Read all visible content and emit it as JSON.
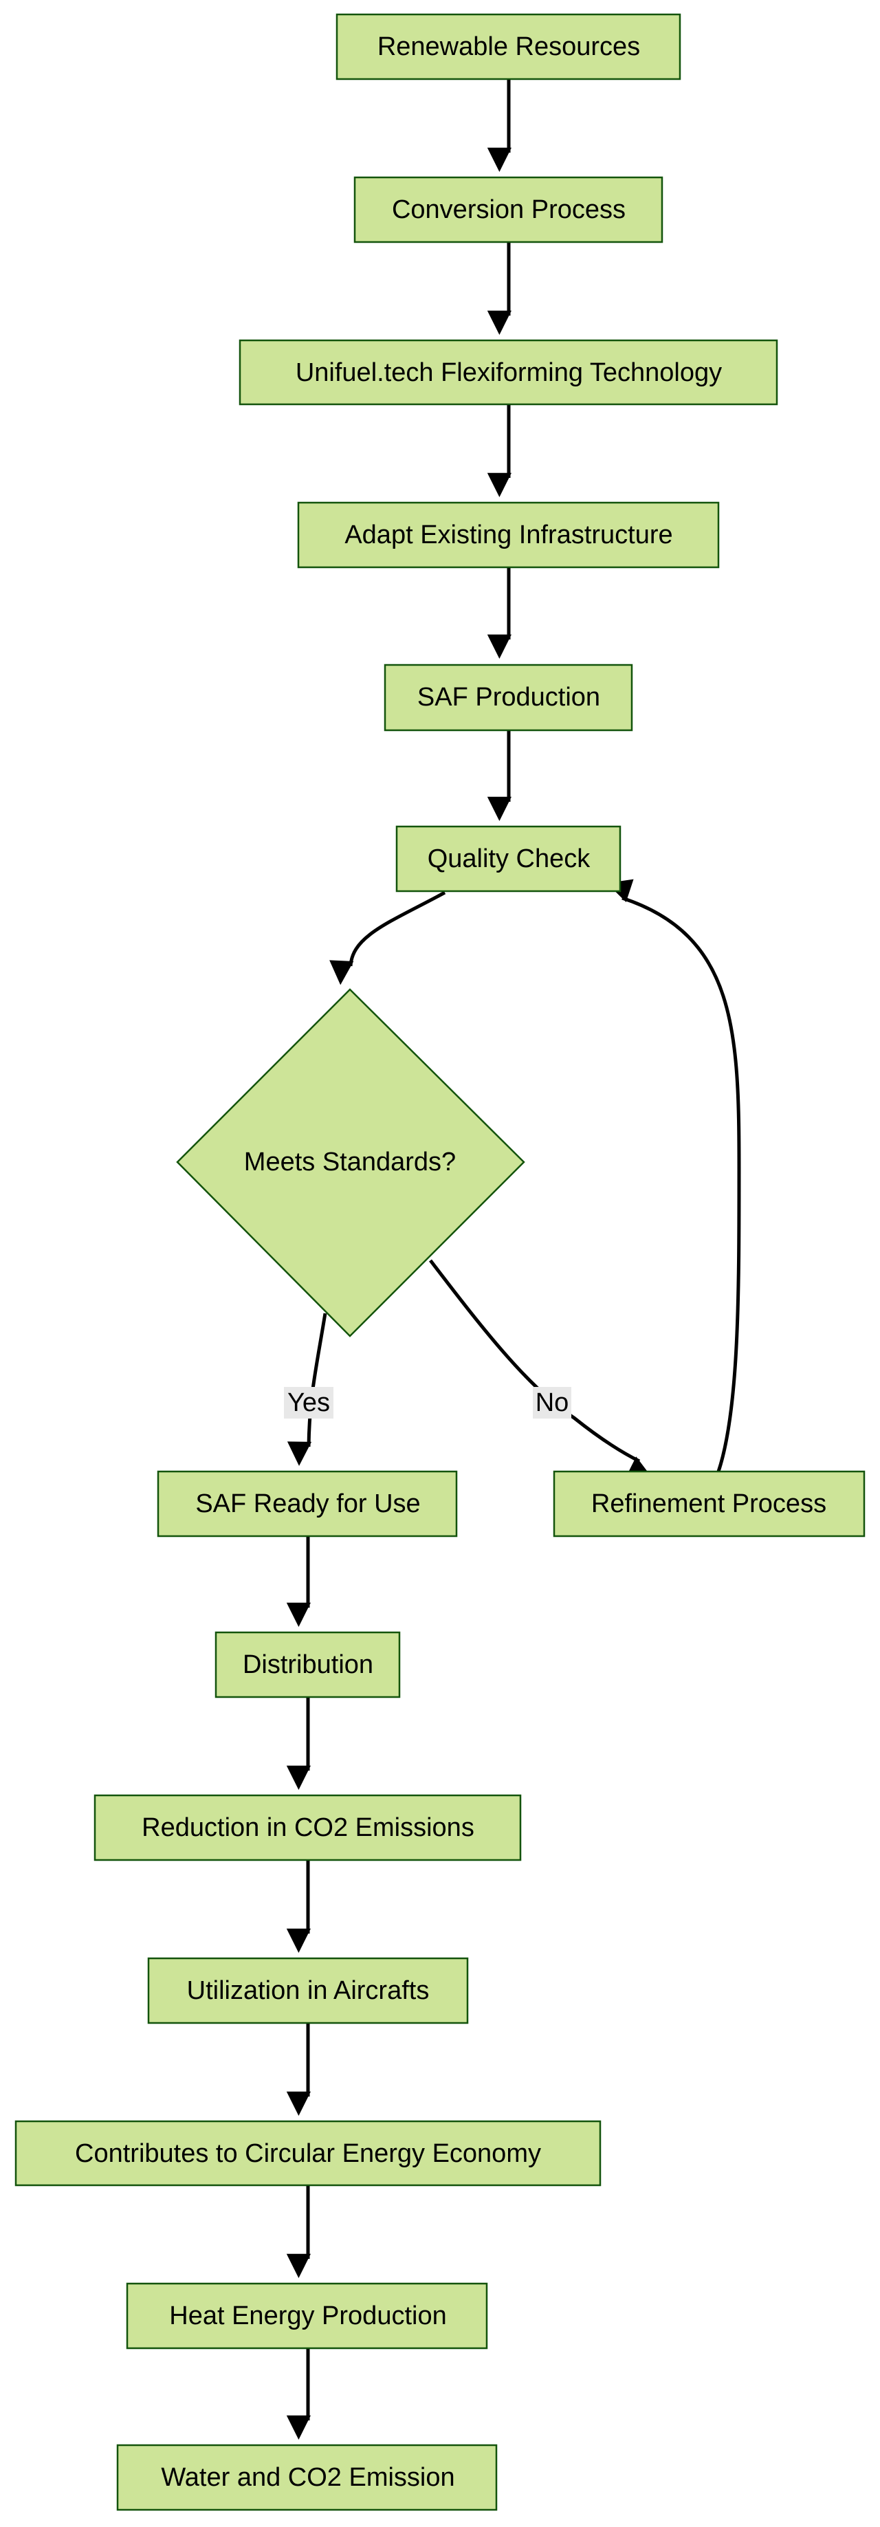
{
  "diagram": {
    "type": "flowchart",
    "colors": {
      "node_fill": "#cde498",
      "node_stroke": "#13540c",
      "edge": "#000000",
      "edge_label_bg": "#e8e8e8"
    },
    "nodes": {
      "renewable": "Renewable Resources",
      "conversion": "Conversion Process",
      "unifuel": "Unifuel.tech Flexiforming Technology",
      "adapt": "Adapt Existing Infrastructure",
      "saf_production": "SAF Production",
      "quality": "Quality Check",
      "meets": "Meets Standards?",
      "saf_ready": "SAF Ready for Use",
      "refinement": "Refinement Process",
      "distribution": "Distribution",
      "reduction": "Reduction in CO2 Emissions",
      "utilization": "Utilization in Aircrafts",
      "circular": "Contributes to Circular Energy Economy",
      "heat": "Heat Energy Production",
      "water": "Water and CO2 Emission"
    },
    "edge_labels": {
      "yes": "Yes",
      "no": "No"
    }
  }
}
